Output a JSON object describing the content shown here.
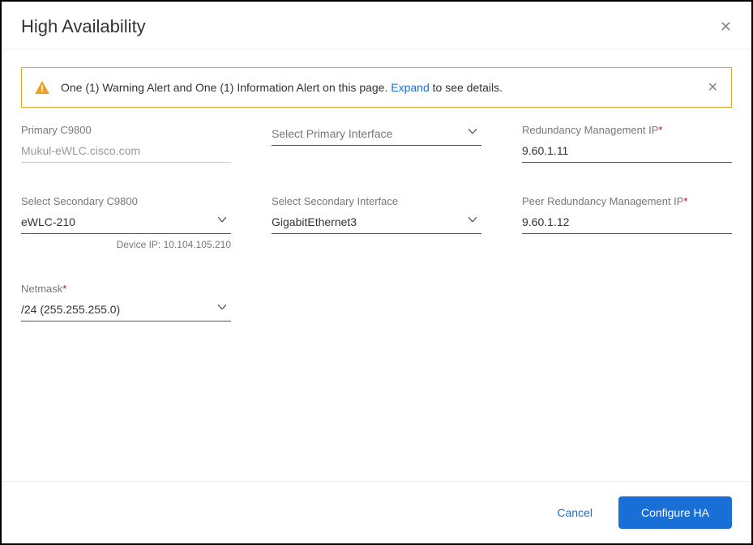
{
  "header": {
    "title": "High Availability"
  },
  "alert": {
    "message_pre": "One (1) Warning Alert and One (1) Information Alert on this page. ",
    "expand": "Expand",
    "message_post": " to see details."
  },
  "fields": {
    "primary_c9800": {
      "label": "Primary C9800",
      "value": "Mukul-eWLC.cisco.com"
    },
    "primary_iface": {
      "label": "",
      "placeholder": "Select Primary Interface"
    },
    "rmi": {
      "label": "Redundancy Management IP",
      "value": "9.60.1.11"
    },
    "secondary_c9800": {
      "label": "Select Secondary C9800",
      "value": "eWLC-210",
      "helper": "Device IP: 10.104.105.210"
    },
    "secondary_iface": {
      "label": "Select Secondary Interface",
      "value": "GigabitEthernet3"
    },
    "peer_rmi": {
      "label": "Peer Redundancy Management IP",
      "value": "9.60.1.12"
    },
    "netmask": {
      "label": "Netmask",
      "value": "/24 (255.255.255.0)"
    }
  },
  "footer": {
    "cancel": "Cancel",
    "primary": "Configure HA"
  }
}
